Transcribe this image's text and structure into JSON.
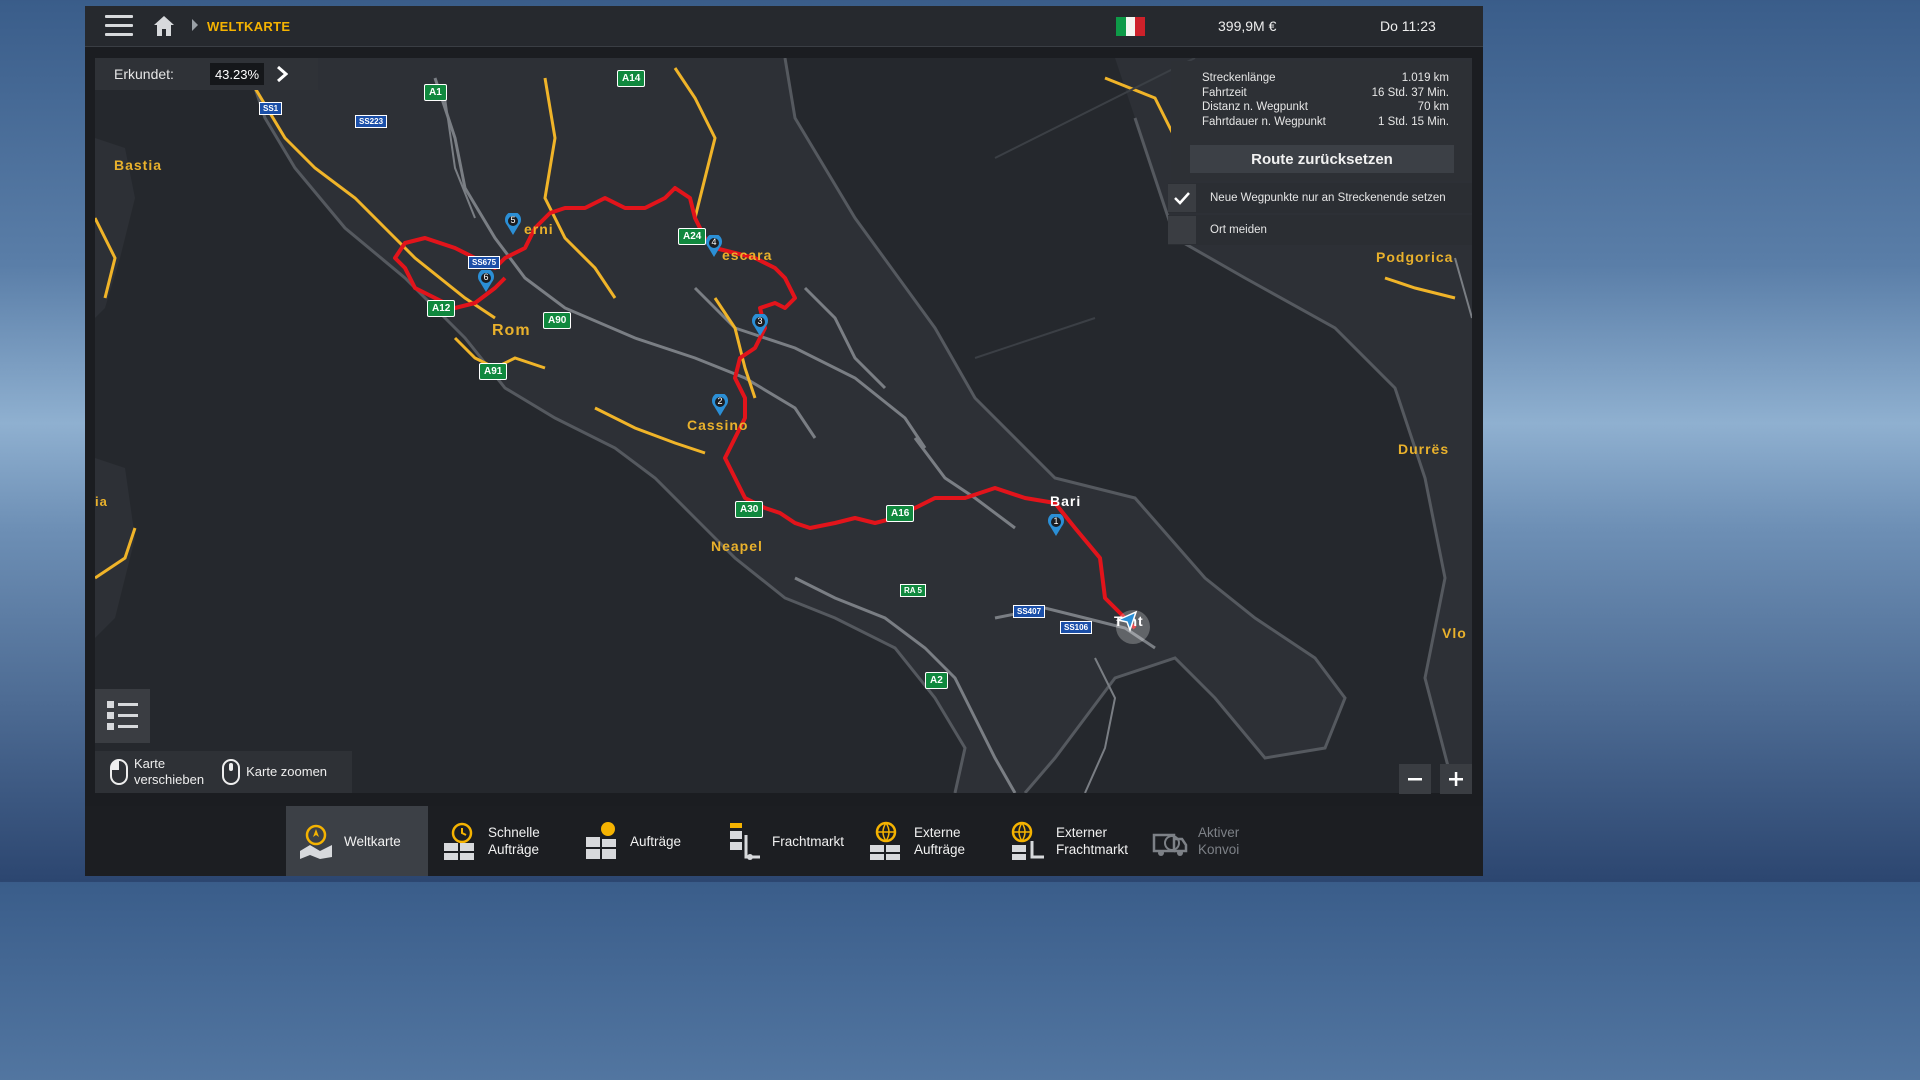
{
  "topbar": {
    "breadcrumb": "WELTKARTE",
    "money": "399,9M €",
    "clock": "Do 11:23",
    "country_flag": "italy-flag"
  },
  "map": {
    "explored_label": "Erkundet:",
    "explored_value": "43.23%",
    "cities": [
      {
        "name": "Bastia"
      },
      {
        "name": "erni"
      },
      {
        "name": "escara"
      },
      {
        "name": "Rom"
      },
      {
        "name": "Cassino"
      },
      {
        "name": "Neapel"
      },
      {
        "name": "Bari"
      },
      {
        "name": "T   nt"
      },
      {
        "name": "Podgorica"
      },
      {
        "name": "Durrës"
      },
      {
        "name": "Vlo"
      },
      {
        "name": "ia"
      }
    ],
    "road_badges": [
      "A1",
      "A14",
      "A24",
      "A90",
      "A12",
      "A91",
      "A30",
      "A16",
      "A2",
      "SS1",
      "SS223",
      "SS675",
      "SS407",
      "SS106",
      "RA 5"
    ],
    "waypoints": [
      "1",
      "2",
      "3",
      "4",
      "5",
      "6"
    ],
    "route_color": "#e2141b",
    "road_color": "#f0b429"
  },
  "route_panel": {
    "rows": [
      {
        "label": "Streckenlänge",
        "value": "1.019 km"
      },
      {
        "label": "Fahrtzeit",
        "value": "16 Std. 37 Min."
      },
      {
        "label": "Distanz n. Wegpunkt",
        "value": "70 km"
      },
      {
        "label": "Fahrtdauer n. Wegpunkt",
        "value": "1 Std. 15 Min."
      }
    ],
    "reset_button": "Route zurücksetzen"
  },
  "options": {
    "waypoint_end": {
      "label": "Neue Wegpunkte nur an Streckenende setzen",
      "checked": true
    },
    "avoid_city": {
      "label": "Ort meiden",
      "checked": false
    }
  },
  "hints": {
    "move_line1": "Karte",
    "move_line2": "verschieben",
    "zoom": "Karte zoomen"
  },
  "bottom_nav": [
    {
      "line1": "Weltkarte",
      "line2": "",
      "active": true
    },
    {
      "line1": "Schnelle",
      "line2": "Aufträge"
    },
    {
      "line1": "Aufträge",
      "line2": ""
    },
    {
      "line1": "Frachtmarkt",
      "line2": ""
    },
    {
      "line1": "Externe",
      "line2": "Aufträge"
    },
    {
      "line1": "Externer",
      "line2": "Frachtmarkt"
    },
    {
      "line1": "Aktiver",
      "line2": "Konvoi",
      "disabled": true
    }
  ]
}
